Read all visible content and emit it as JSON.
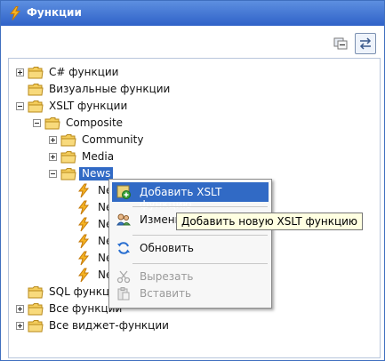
{
  "window": {
    "title": "Функции"
  },
  "tree": {
    "items": [
      {
        "label": "C# функции"
      },
      {
        "label": "Визуальные функции"
      },
      {
        "label": "XSLT функции"
      },
      {
        "label": "Composite"
      },
      {
        "label": "Community"
      },
      {
        "label": "Media"
      },
      {
        "label": "News"
      },
      {
        "label": "Ne"
      },
      {
        "label": "Ne"
      },
      {
        "label": "Ne"
      },
      {
        "label": "Ne"
      },
      {
        "label": "Ne"
      },
      {
        "label": "Ne"
      },
      {
        "label": "SQL функци"
      },
      {
        "label": "Все функции"
      },
      {
        "label": "Все виджет-функции"
      }
    ]
  },
  "context_menu": {
    "add_xslt": "Добавить XSLT функцию",
    "edit": "Измени",
    "refresh": "Обновить",
    "cut": "Вырезать",
    "paste": "Вставить"
  },
  "tooltip": {
    "text": "Добавить новую XSLT функцию"
  },
  "colors": {
    "title_bar": "#2f62c8",
    "selection": "#316ac5",
    "folder": "#f0c64a",
    "function_icon": "#f2a81c"
  },
  "icons": [
    "lightning-icon",
    "collapse-all-icon",
    "link-sync-icon",
    "folder-icon",
    "add-function-icon",
    "edit-users-icon",
    "refresh-icon",
    "cut-icon",
    "paste-icon"
  ]
}
